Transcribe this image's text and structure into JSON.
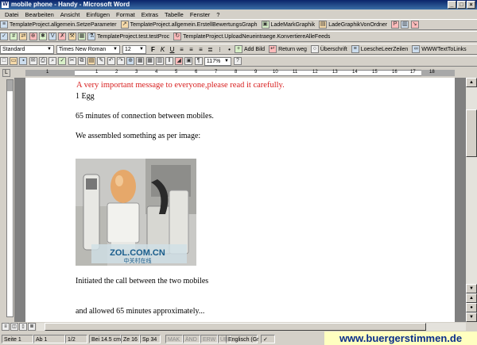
{
  "window": {
    "title": "mobile phone - Handy - Microsoft Word"
  },
  "menu": [
    "Datei",
    "Bearbeiten",
    "Ansicht",
    "Einfügen",
    "Format",
    "Extras",
    "Tabelle",
    "Fenster",
    "?"
  ],
  "toolbar1": [
    "TemplateProject.allgemein.SetzeParameter",
    "TemplateProject.allgemein.ErstellBewertungsGraph",
    "LadeMarkGraphik",
    "LadeGraphikVonOrdner"
  ],
  "toolbar2": [
    "TemplateProject.test.testProc",
    "TemplateProject.UploadNeueintraege.KonvertiereAlleFeeds"
  ],
  "formatting": {
    "style": "Standard",
    "font": "Times New Roman",
    "size": "12",
    "add_image": "Add Bild",
    "return_label": "Return weg",
    "heading_label": "Überschrift",
    "delete_lines": "LoescheLeerZeilen",
    "text_links": "WWWTextToLinks"
  },
  "standard_toolbar": {
    "zoom": "117%"
  },
  "ruler": {
    "numbers": [
      "1",
      "1",
      "2",
      "3",
      "4",
      "5",
      "6",
      "7",
      "8",
      "9",
      "10",
      "11",
      "12",
      "13",
      "14",
      "15",
      "16",
      "17",
      "18"
    ]
  },
  "document": {
    "heading": "A very important message to everyone,please read it carefully.",
    "line1": "1 Egg",
    "line2": "65 minutes of connection between mobiles.",
    "line3": "We assembled something as per image:",
    "image_caption": "ZOL.COM.CN",
    "image_subcaption": "中关村在线",
    "line4": "Initiated the call between the two mobiles",
    "line5": "and allowed 65 minutes approximately..."
  },
  "status": {
    "page": "Seite 1",
    "section": "Ab 1",
    "pages": "1/2",
    "position": "Bei 14.5 cm",
    "line": "Ze 16",
    "col": "Sp 34",
    "mak": "MAK",
    "aend": "ÄND",
    "erw": "ERW",
    "ub": "ÜB",
    "language": "Englisch (Gr"
  },
  "watermark": "www.buergerstimmen.de"
}
